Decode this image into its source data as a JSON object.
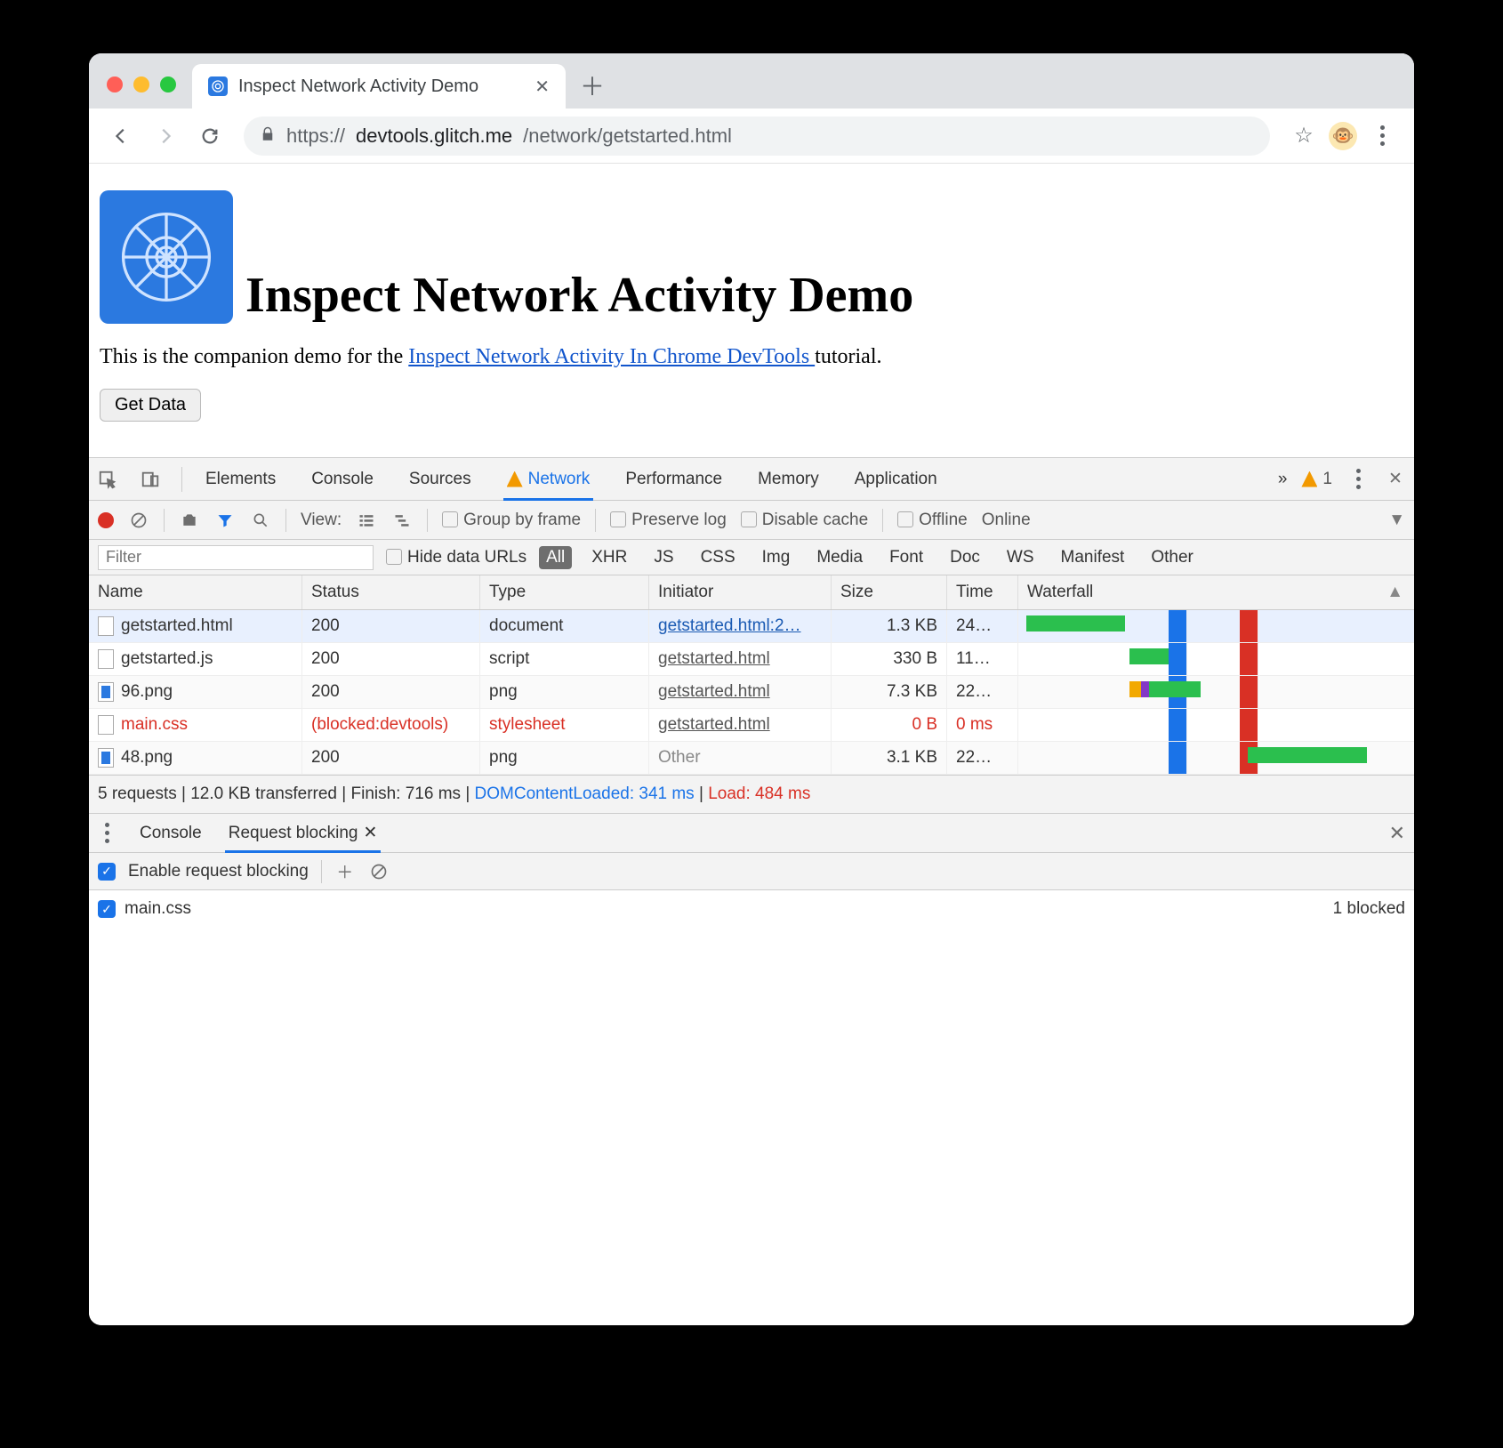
{
  "browser": {
    "tab_title": "Inspect Network Activity Demo",
    "url_prefix": "https://",
    "url_host": "devtools.glitch.me",
    "url_path": "/network/getstarted.html"
  },
  "page": {
    "heading": "Inspect Network Activity Demo",
    "intro_pre": "This is the companion demo for the ",
    "intro_link": "Inspect Network Activity In Chrome DevTools ",
    "intro_post": "tutorial.",
    "button": "Get Data"
  },
  "devtools": {
    "tabs": [
      "Elements",
      "Console",
      "Sources",
      "Network",
      "Performance",
      "Memory",
      "Application"
    ],
    "active_tab": "Network",
    "more": "»",
    "warning_count": "1",
    "toolbar": {
      "view_label": "View:",
      "group_by_frame": "Group by frame",
      "preserve_log": "Preserve log",
      "disable_cache": "Disable cache",
      "offline": "Offline",
      "online": "Online"
    },
    "filter": {
      "placeholder": "Filter",
      "hide_data_urls": "Hide data URLs",
      "types": [
        "All",
        "XHR",
        "JS",
        "CSS",
        "Img",
        "Media",
        "Font",
        "Doc",
        "WS",
        "Manifest",
        "Other"
      ],
      "active_type": "All"
    },
    "columns": [
      "Name",
      "Status",
      "Type",
      "Initiator",
      "Size",
      "Time",
      "Waterfall"
    ],
    "rows": [
      {
        "name": "getstarted.html",
        "status": "200",
        "type": "document",
        "initiator": "getstarted.html:2…",
        "size": "1.3 KB",
        "time": "24…",
        "blocked": false,
        "wf": {
          "start": 2,
          "len": 25
        },
        "icon": "doc",
        "selected": true
      },
      {
        "name": "getstarted.js",
        "status": "200",
        "type": "script",
        "initiator": "getstarted.html",
        "size": "330 B",
        "time": "11…",
        "blocked": false,
        "wf": {
          "start": 28,
          "len": 10
        },
        "icon": "doc"
      },
      {
        "name": "96.png",
        "status": "200",
        "type": "png",
        "initiator": "getstarted.html",
        "size": "7.3 KB",
        "time": "22…",
        "blocked": false,
        "wf": {
          "start": 28,
          "len": 18,
          "multi": true
        },
        "icon": "img"
      },
      {
        "name": "main.css",
        "status": "(blocked:devtools)",
        "type": "stylesheet",
        "initiator": "getstarted.html",
        "size": "0 B",
        "time": "0 ms",
        "blocked": true,
        "wf": {},
        "icon": "doc"
      },
      {
        "name": "48.png",
        "status": "200",
        "type": "png",
        "initiator": "Other",
        "size": "3.1 KB",
        "time": "22…",
        "blocked": false,
        "wf": {
          "start": 58,
          "len": 30
        },
        "icon": "img",
        "initiator_plain": true
      }
    ],
    "summary": {
      "requests": "5 requests",
      "transferred": "12.0 KB transferred",
      "finish": "Finish: 716 ms",
      "dcl": "DOMContentLoaded: 341 ms",
      "load": "Load: 484 ms"
    },
    "drawer": {
      "tabs": [
        "Console",
        "Request blocking"
      ],
      "active": "Request blocking",
      "enable_label": "Enable request blocking",
      "pattern": "main.css",
      "blocked_count": "1 blocked"
    }
  }
}
